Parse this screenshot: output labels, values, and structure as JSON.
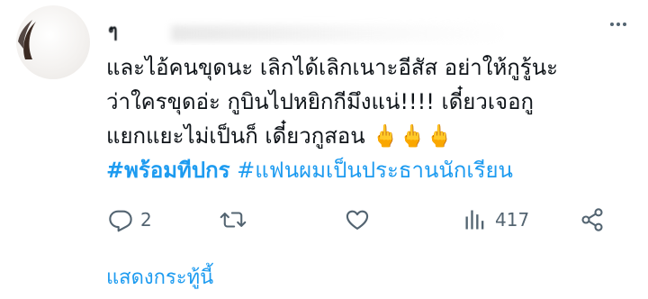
{
  "tweet": {
    "author_name": "ๆ",
    "lines": [
      "และไอ้คนขุดนะ เลิกได้เลิกเนาะอีสัส อย่าให้กูรู้นะ",
      "ว่าใครขุดอ่ะ กูบินไปหยิกกีมึงแน่!!!! เดี๋ยวเจอกู",
      "แยกแยะไม่เป็นก็ เดี๋ยวกูสอน 🖕🖕🖕"
    ],
    "hashtags": [
      "#พร้อมทีปกร",
      "#แฟนผมเป็นประธานนักเรียน"
    ],
    "reply_count": "2",
    "view_count": "417",
    "show_thread_label": "แสดงกระทู้นี้"
  },
  "colors": {
    "text": "#0f1419",
    "secondary": "#536471",
    "accent": "#1d9bf0"
  },
  "icons": {
    "more": "more-icon",
    "reply": "reply-icon",
    "retweet": "retweet-icon",
    "like": "heart-icon",
    "views": "views-icon",
    "share": "share-icon"
  }
}
